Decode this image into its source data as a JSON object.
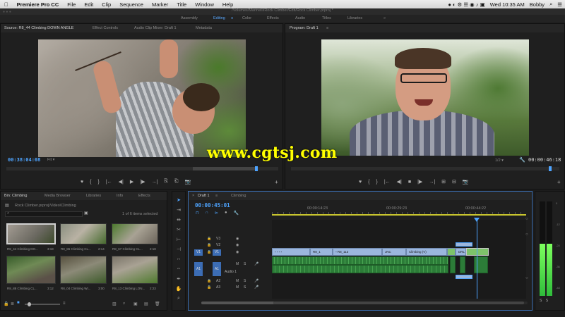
{
  "menubar": {
    "app_name": "Premiere Pro CC",
    "items": [
      "File",
      "Edit",
      "Clip",
      "Sequence",
      "Marker",
      "Title",
      "Window",
      "Help"
    ],
    "clock": "Wed 10:35 AM",
    "user": "Bobby"
  },
  "project_path": "/Volumes/Marinelli/Rock Climber/Edit/Rock Climber.prproj *",
  "workspaces": {
    "items": [
      "Assembly",
      "Editing",
      "Color",
      "Effects",
      "Audio",
      "Titles",
      "Libraries"
    ],
    "active": "Editing",
    "more": "»"
  },
  "source_panel": {
    "tabs": [
      "Source: R8_44 Climbing DOWN ANGLE",
      "Effect Controls",
      "Audio Clip Mixer: Draft 1",
      "Metadata"
    ],
    "timecode": "00:38:04:08",
    "fit": "Fit",
    "controls": [
      "♥",
      "{",
      "}",
      "|←",
      "◀|",
      "▶",
      "|▶",
      "→|",
      "⎘",
      "⎗",
      "📷"
    ]
  },
  "program_panel": {
    "tabs": [
      "Program: Draft 1"
    ],
    "quality": "1/2",
    "duration": "00:00:46:18",
    "controls": [
      "♥",
      "{",
      "}",
      "|←",
      "◀|",
      "■",
      "|▶",
      "→|",
      "⊞",
      "⊟",
      "📷"
    ]
  },
  "bin_panel": {
    "tabs": [
      "Bin: Climbing",
      "Media Browser",
      "Libraries",
      "Info",
      "Effects"
    ],
    "path": "Rock Climber.prproj\\Video\\Climbing",
    "selection": "1 of 6 items selected",
    "clips": [
      {
        "name": "R8_44 Climbing DO...",
        "dur": "3:19"
      },
      {
        "name": "R8_86 Climbing CL...",
        "dur": "2:14"
      },
      {
        "name": "R8_67 Climbing CL...",
        "dur": "2:18"
      },
      {
        "name": "R8_88 Climbing CL...",
        "dur": "3:12"
      },
      {
        "name": "R8_04 Climbing WI...",
        "dur": "3:00"
      },
      {
        "name": "R8_13 Climbing LON...",
        "dur": "2:23"
      }
    ]
  },
  "timeline": {
    "tabs": [
      "Draft 1",
      "Climbing"
    ],
    "timecode": "00:00:45:01",
    "ruler": [
      "00:00:14:23",
      "00:00:29:23",
      "00:00:44:22"
    ],
    "video_tracks": [
      "V3",
      "V2",
      "V1"
    ],
    "audio_tracks": [
      "A1",
      "A2",
      "A3"
    ],
    "audio_label": "Audio 1",
    "clip_labels": [
      "R8_1",
      "R8_113",
      "JNC",
      "Climbing (V)",
      "DRL"
    ]
  },
  "meters": {
    "level": 0.55,
    "scale": [
      "0",
      "-12",
      "-24",
      "-36",
      "-48"
    ]
  },
  "watermark": "www.cgtsj.com",
  "colors": {
    "accent": "#4ea4ff",
    "video_clip": "#9bb6dd",
    "audio_clip": "#2c7c38",
    "playhead": "#4ea4ff",
    "meter_green": "#3bd14a"
  }
}
